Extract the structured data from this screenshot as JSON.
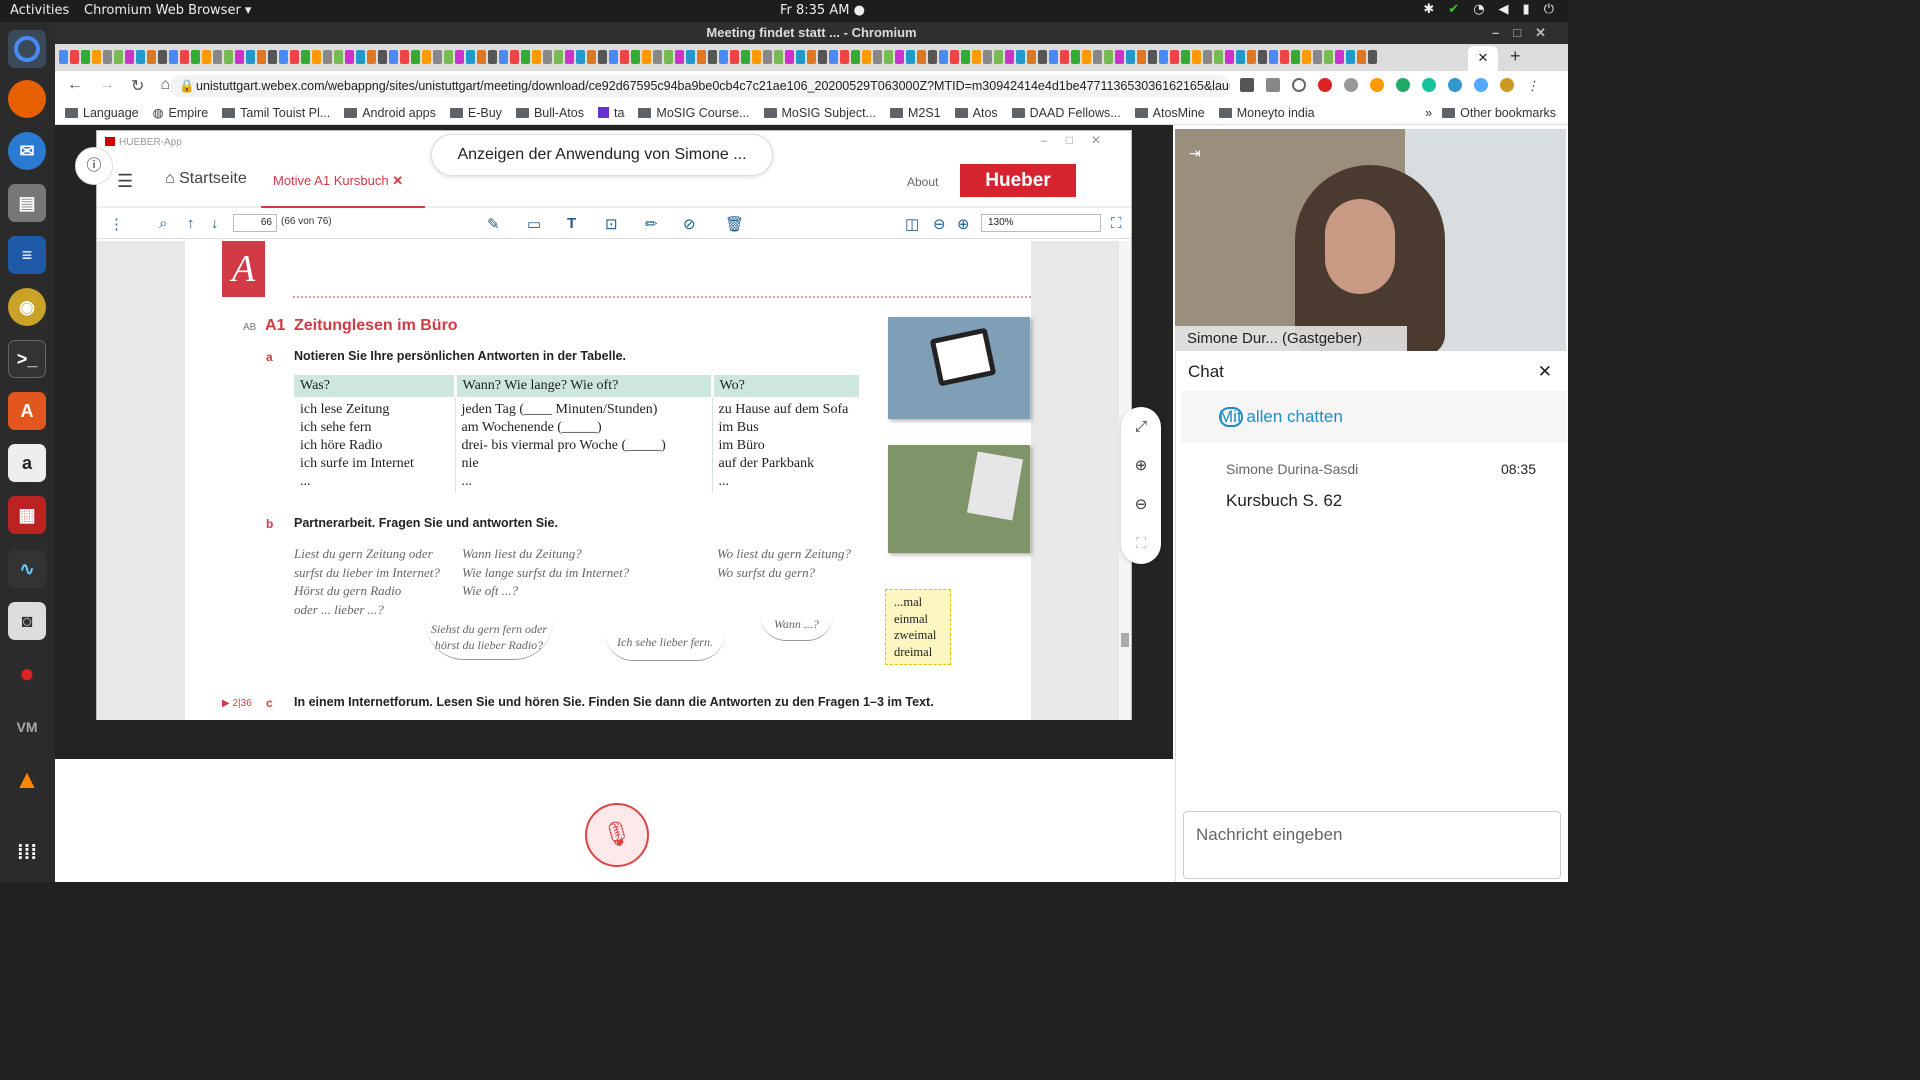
{
  "topbar": {
    "activities": "Activities",
    "app": "Chromium Web Browser ▾",
    "clock": "Fr  8:35 AM ●"
  },
  "dock": [
    "chromium-icon",
    "firefox-icon",
    "thunderbird-icon",
    "files-icon",
    "writer-icon",
    "rhythmbox-icon",
    "terminal-icon",
    "software-icon",
    "amazon-icon",
    "screen-icon",
    "monitor-icon",
    "camera-icon",
    "cherry-icon",
    "vm-icon",
    "vlc-icon",
    "apps-grid-icon"
  ],
  "window": {
    "title": "Meeting findet statt ... - Chromium"
  },
  "tabs": {
    "active_close": "✕",
    "new_tab": "+"
  },
  "address": {
    "url": "unistuttgart.webex.com/webappng/sites/unistuttgart/meeting/download/ce92d67595c94ba9be0cb4c7c21ae106_20200529T063000Z?MTID=m30942414e4d1be477113653036162165&launchApp..."
  },
  "bookmarks": [
    "Language",
    "Empire",
    "Tamil Touist Pl...",
    "Android apps",
    "E-Buy",
    "Bull-Atos",
    "ta",
    "MoSIG Course...",
    "MoSIG Subject...",
    "M2S1",
    "Atos",
    "DAAD Fellows...",
    "AtosMine",
    "Moneyto india"
  ],
  "bookmarks_more": "»",
  "bookmarks_other": "Other bookmarks",
  "share": {
    "banner": "Anzeigen der Anwendung von Simone ...",
    "app_window_title": "HUEBER-App",
    "home": "Startseite",
    "doc_tab": "Motive A1 Kursbuch",
    "about": "About",
    "logo": "Hueber",
    "page_input": "66",
    "page_of": "(66 von 76)",
    "zoom": "130%"
  },
  "textbook": {
    "unit_letter": "A",
    "ab": "AB",
    "exercise": "A1",
    "title": "Zeitunglesen im Büro",
    "a_label": "a",
    "a_text": "Notieren Sie Ihre persönlichen Antworten in der Tabelle.",
    "table_headers": [
      "Was?",
      "Wann? Wie lange? Wie oft?",
      "Wo?"
    ],
    "col1": [
      "ich lese Zeitung",
      "ich sehe fern",
      "ich höre Radio",
      "ich surfe im Internet",
      "..."
    ],
    "col2": [
      "jeden Tag (____ Minuten/Stunden)",
      "am Wochenende (_____)",
      "drei- bis viermal pro Woche (_____)",
      "nie",
      "..."
    ],
    "col3": [
      "zu Hause auf dem Sofa",
      "im Bus",
      "im Büro",
      "auf der Parkbank",
      "..."
    ],
    "b_label": "b",
    "b_text": "Partnerarbeit. Fragen Sie und antworten Sie.",
    "q1": [
      "Liest du gern Zeitung oder",
      "surfst du lieber im Internet?",
      "Hörst du gern Radio",
      "oder ... lieber ...?"
    ],
    "q2": [
      "Wann liest du Zeitung?",
      "Wie lange surfst du im Internet?",
      "Wie oft ...?"
    ],
    "q3": [
      "Wo liest du gern Zeitung?",
      "Wo surfst du gern?"
    ],
    "bubble1": [
      "Siehst du gern fern oder",
      "hörst du lieber Radio?"
    ],
    "bubble2": "Ich sehe lieber fern.",
    "bubble3": "Wann ...?",
    "box": [
      "...mal",
      "einmal",
      "zweimal",
      "dreimal"
    ],
    "c_track": "▶ 2|36",
    "c_label": "c",
    "c_text": "In einem Internetforum. Lesen Sie und hören Sie. Finden Sie dann die Antworten zu den Fragen 1–3 im Text."
  },
  "video": {
    "name": "Simone Dur... (Gastgeber)"
  },
  "chat": {
    "title": "Chat",
    "close": "✕",
    "to": "Mit allen chatten",
    "sender": "Simone Durina-Sasdi",
    "time": "08:35",
    "message": "Kursbuch S. 62",
    "input_placeholder": "Nachricht eingeben"
  }
}
